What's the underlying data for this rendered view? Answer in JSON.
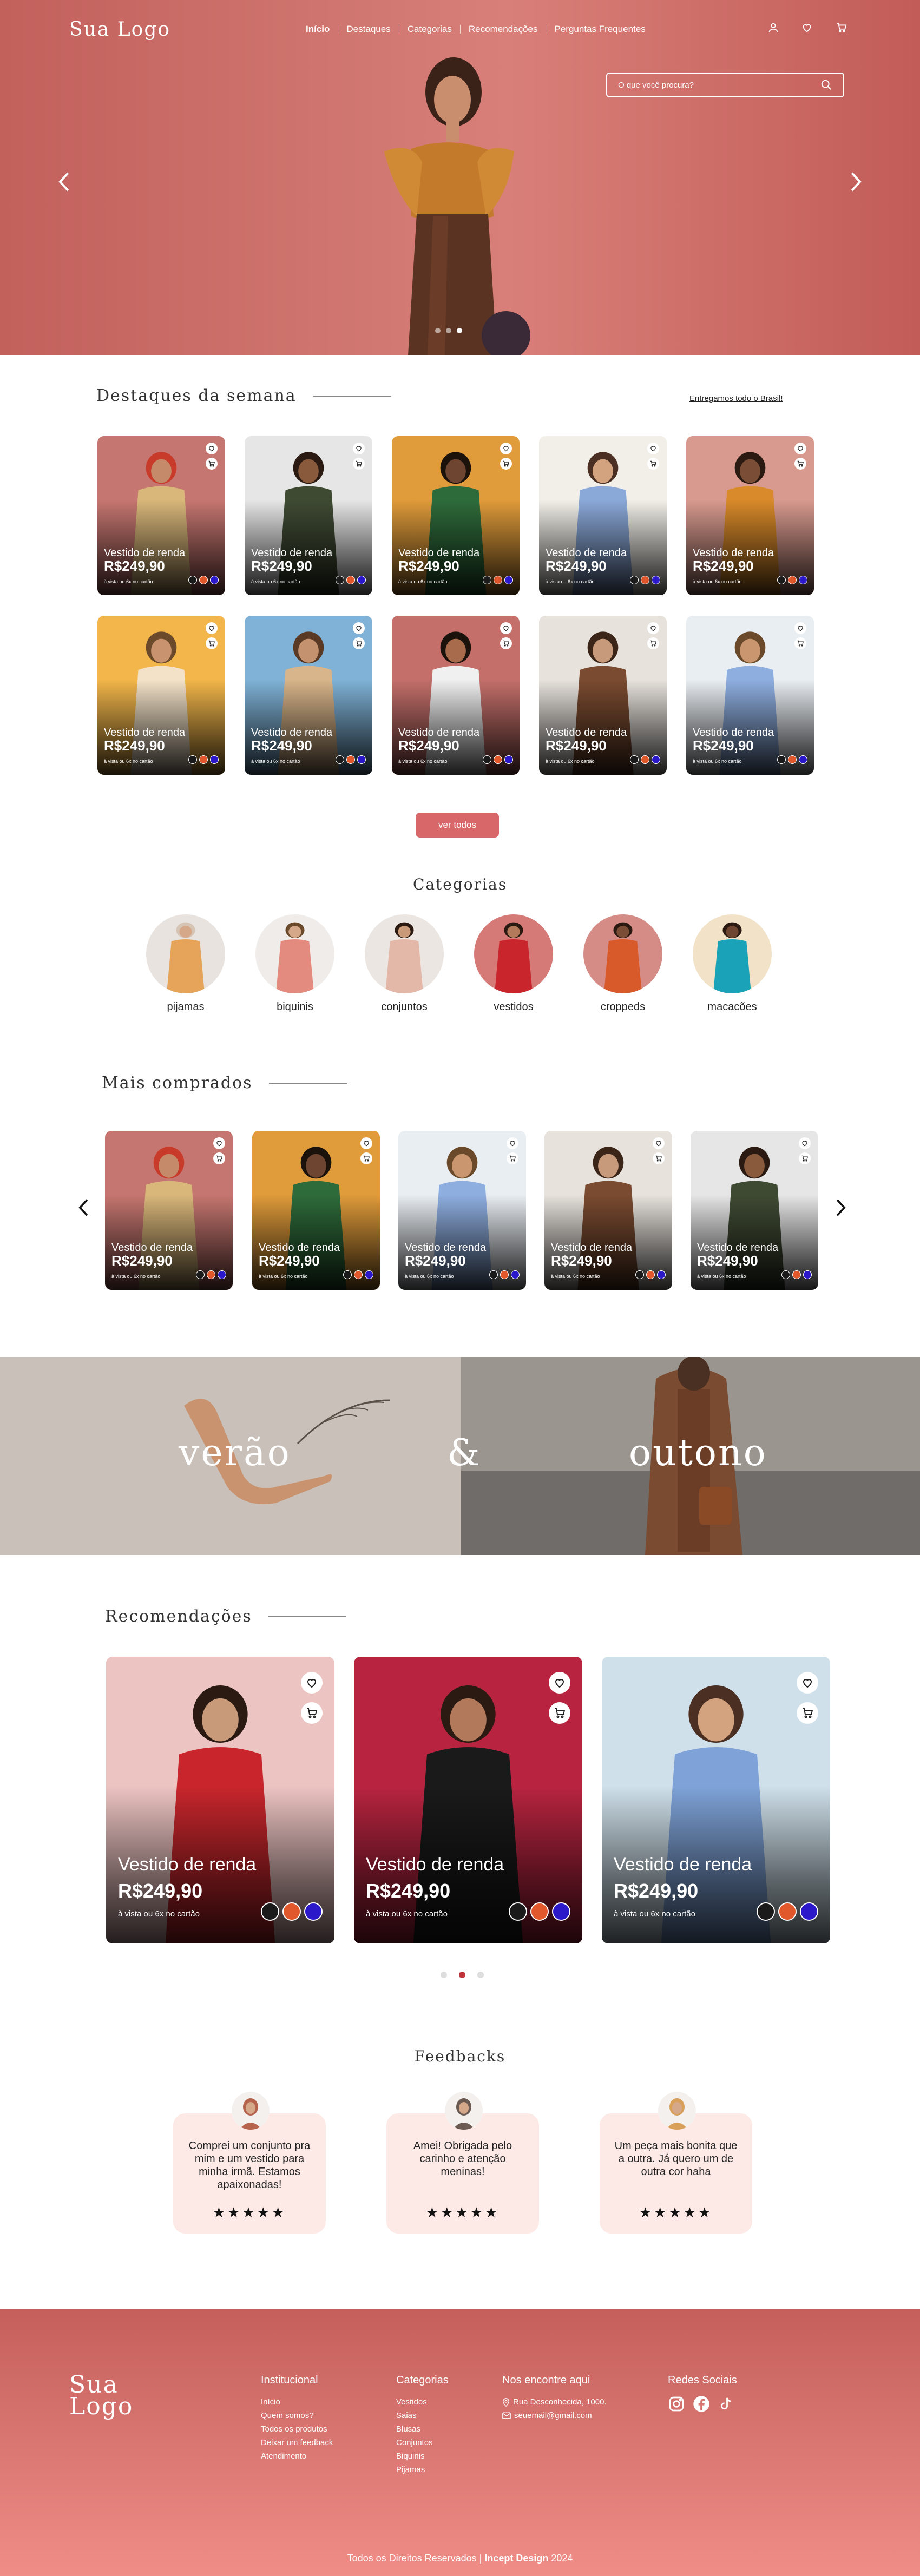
{
  "header": {
    "logo": "Sua Logo",
    "nav": [
      "Início",
      "Destaques",
      "Categorias",
      "Recomendações",
      "Perguntas Frequentes"
    ],
    "icons": [
      "user-icon",
      "heart-icon",
      "cart-icon"
    ],
    "search_placeholder": "O que você procura?"
  },
  "hero": {
    "slides": 3,
    "active_slide": 2
  },
  "destaques": {
    "title": "Destaques da semana",
    "shipping_link": "Entregamos todo o Brasil!",
    "product": {
      "name": "Vestido de renda",
      "price": "R$249,90",
      "sub": "à vista ou 6x no cartão",
      "colors": [
        "#1a1a1a",
        "#e0582c",
        "#2b19c9"
      ]
    },
    "button": "ver todos"
  },
  "categorias": {
    "title": "Categorias",
    "items": [
      "pijamas",
      "biquinis",
      "conjuntos",
      "vestidos",
      "croppeds",
      "macacões"
    ]
  },
  "mais_comprados": {
    "title": "Mais comprados"
  },
  "banner": {
    "left": "verão",
    "mid": "&",
    "right": "outono"
  },
  "recomendacoes": {
    "title": "Recomendações",
    "dots": 3,
    "active_dot": 2
  },
  "feedbacks": {
    "title": "Feedbacks",
    "items": [
      {
        "text": "Comprei um conjunto pra mim e um vestido para minha irmã. Estamos apaixonadas!",
        "stars": "★★★★★"
      },
      {
        "text": "Amei! Obrigada pelo carinho e atenção meninas!",
        "stars": "★★★★★"
      },
      {
        "text": "Um peça mais bonita que a outra. Já quero um de outra cor haha",
        "stars": "★★★★★"
      }
    ]
  },
  "footer": {
    "logo_line1": "Sua",
    "logo_line2": "Logo",
    "institucional": {
      "title": "Institucional",
      "links": [
        "Início",
        "Quem somos?",
        "Todos os produtos",
        "Deixar um feedback",
        "Atendimento"
      ]
    },
    "categorias": {
      "title": "Categorias",
      "links": [
        "Vestidos",
        "Saias",
        "Blusas",
        "Conjuntos",
        "Biquinis",
        "Pijamas"
      ]
    },
    "contato": {
      "title": "Nos encontre aqui",
      "address": "Rua Desconhecida, 1000.",
      "email": "seuemail@gmail.com"
    },
    "social": {
      "title": "Redes Sociais",
      "icons": [
        "instagram-icon",
        "facebook-icon",
        "tiktok-icon"
      ]
    },
    "copyright_prefix": "Todos os Direitos Reservados | ",
    "copyright_brand": "Incept Design",
    "copyright_year": " 2024"
  }
}
